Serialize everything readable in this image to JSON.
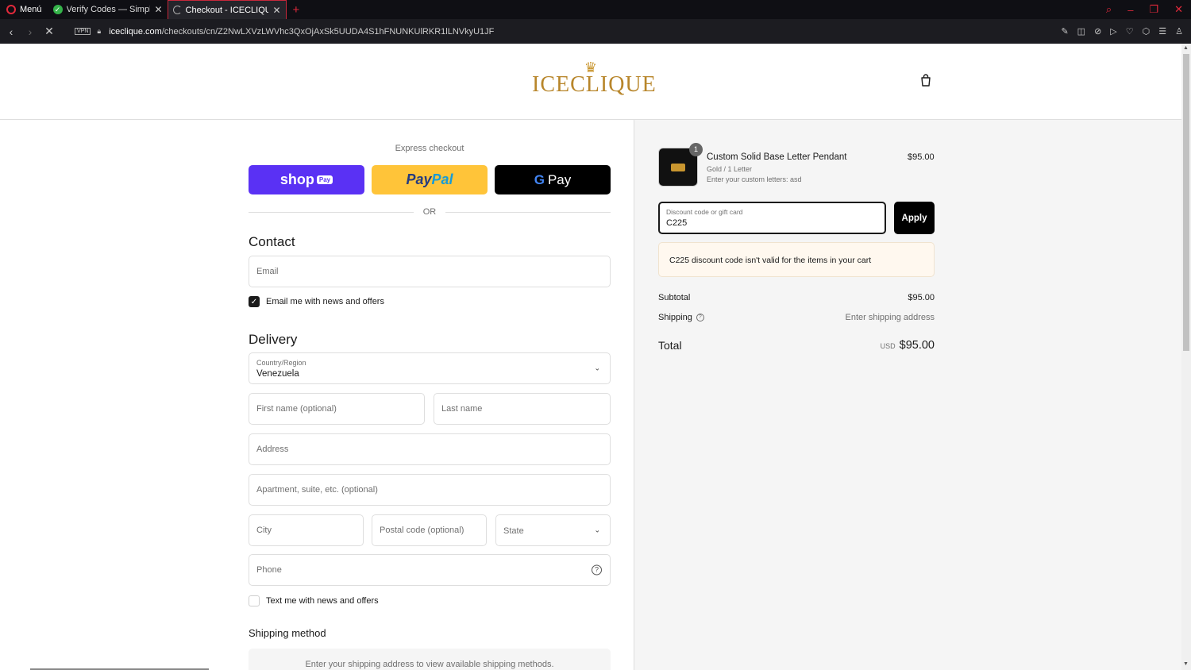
{
  "browser": {
    "menu_label": "Menú",
    "tabs": [
      {
        "label": "Verify Codes — SimplyCod"
      },
      {
        "label": "Checkout - ICECLIQUE JEW"
      }
    ],
    "url_host": "iceclique.com",
    "url_path": "/checkouts/cn/Z2NwLXVzLWVhc3QxOjAxSk5UUDA4S1hFNUNKUlRKR1lLNVkyU1JF",
    "vpn_label": "VPN"
  },
  "header": {
    "brand": "ICECLIQUE"
  },
  "express": {
    "title": "Express checkout",
    "shop_label": "shop",
    "shop_pill": "Pay",
    "paypal_a": "Pay",
    "paypal_b": "Pal",
    "gpay_g": "G",
    "gpay_label": "Pay",
    "or_label": "OR"
  },
  "contact": {
    "title": "Contact",
    "email_placeholder": "Email",
    "newsletter_label": "Email me with news and offers",
    "newsletter_checked": true
  },
  "delivery": {
    "title": "Delivery",
    "country_label": "Country/Region",
    "country_value": "Venezuela",
    "first_name_placeholder": "First name (optional)",
    "last_name_placeholder": "Last name",
    "address_placeholder": "Address",
    "apartment_placeholder": "Apartment, suite, etc. (optional)",
    "city_placeholder": "City",
    "postal_placeholder": "Postal code (optional)",
    "state_placeholder": "State",
    "phone_placeholder": "Phone",
    "sms_label": "Text me with news and offers",
    "sms_checked": false
  },
  "shipping_method": {
    "title": "Shipping method",
    "message": "Enter your shipping address to view available shipping methods."
  },
  "order": {
    "item": {
      "quantity": "1",
      "name": "Custom Solid Base Letter Pendant",
      "variant": "Gold / 1 Letter",
      "custom": "Enter your custom letters: asd",
      "price": "$95.00"
    },
    "discount": {
      "label": "Discount code or gift card",
      "value": "C225",
      "apply_label": "Apply",
      "error": "C225 discount code isn't valid for the items in your cart"
    },
    "subtotal_label": "Subtotal",
    "subtotal_value": "$95.00",
    "shipping_label": "Shipping",
    "shipping_value": "Enter shipping address",
    "total_label": "Total",
    "total_currency": "USD",
    "total_value": "$95.00"
  },
  "colors": {
    "shop_pay": "#5a31f4",
    "paypal": "#ffc439",
    "gpay": "#000000",
    "brand_gold": "#b8862b",
    "opera_red": "#e2293b"
  }
}
